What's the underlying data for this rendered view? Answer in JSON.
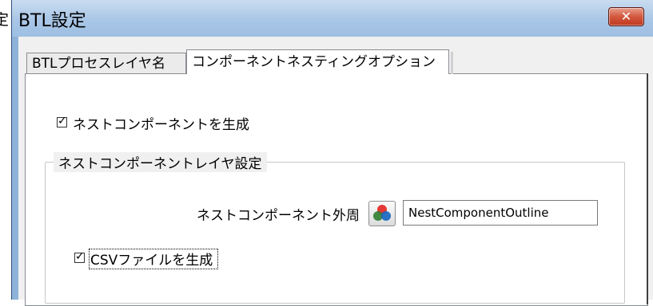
{
  "window": {
    "title": "BTL設定",
    "partial_left_text": "定",
    "close_symbol": "✕"
  },
  "tabs": [
    {
      "label": "BTLプロセスレイヤ名",
      "active": false
    },
    {
      "label": "コンポーネントネスティングオプション",
      "active": true
    }
  ],
  "options": {
    "generate_nested_component": {
      "label": "ネストコンポーネントを生成",
      "checked": true
    },
    "group_title": "ネストコンポーネントレイヤ設定",
    "outline_label": "ネストコンポーネント外周",
    "outline_layer_value": "NestComponentOutline",
    "color_icon": "color-circles-icon",
    "generate_csv": {
      "label": "CSVファイルを生成",
      "checked": true
    }
  },
  "colors": {
    "titlebar": "#a9c6e6",
    "close_button": "#c0391f",
    "panel_background": "#ffffff",
    "dialog_background": "#f0f0f0"
  }
}
